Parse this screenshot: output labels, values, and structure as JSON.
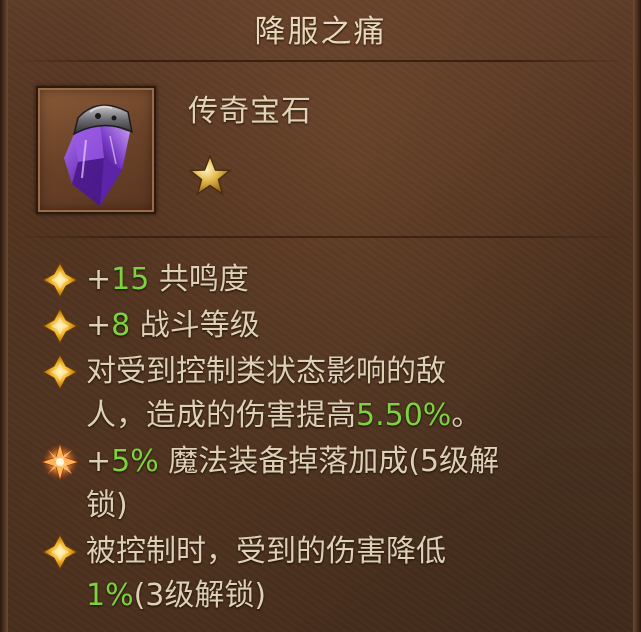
{
  "item": {
    "name": "降服之痛",
    "type": "传奇宝石",
    "rank_stars": 1
  },
  "stats": [
    {
      "lines": [
        [
          {
            "t": "+",
            "c": "n"
          },
          {
            "t": "15",
            "c": "g"
          },
          {
            "t": " 共鸣度",
            "c": "n"
          }
        ]
      ],
      "bullet": "gold"
    },
    {
      "lines": [
        [
          {
            "t": "+",
            "c": "n"
          },
          {
            "t": "8",
            "c": "g"
          },
          {
            "t": " 战斗等级",
            "c": "n"
          }
        ]
      ],
      "bullet": "gold"
    },
    {
      "lines": [
        [
          {
            "t": "对受到控制类状态影响的敌",
            "c": "n"
          }
        ],
        [
          {
            "t": "人，造成的伤害提高",
            "c": "n"
          },
          {
            "t": "5.50%",
            "c": "g"
          },
          {
            "t": "。",
            "c": "n"
          }
        ]
      ],
      "bullet": "gold"
    },
    {
      "lines": [
        [
          {
            "t": "+",
            "c": "n"
          },
          {
            "t": "5%",
            "c": "g"
          },
          {
            "t": " 魔法装备掉落加成(5级解",
            "c": "n"
          }
        ],
        [
          {
            "t": "锁)",
            "c": "n"
          }
        ]
      ],
      "bullet": "orange"
    },
    {
      "lines": [
        [
          {
            "t": "被控制时，受到的伤害降低",
            "c": "n"
          }
        ],
        [
          {
            "t": "1%",
            "c": "g"
          },
          {
            "t": "(3级解锁)",
            "c": "n"
          }
        ]
      ],
      "bullet": "gold"
    }
  ],
  "colors": {
    "value_green": "#7ed13f",
    "text": "#ddd0b5",
    "title": "#e8d7b8"
  },
  "icons": {
    "gem": "purple-crystal-gem-icon",
    "rank": "gold-star-icon",
    "bullet_gold": "gold-diamond-bullet-icon",
    "bullet_orange": "orange-sparkle-bullet-icon"
  }
}
